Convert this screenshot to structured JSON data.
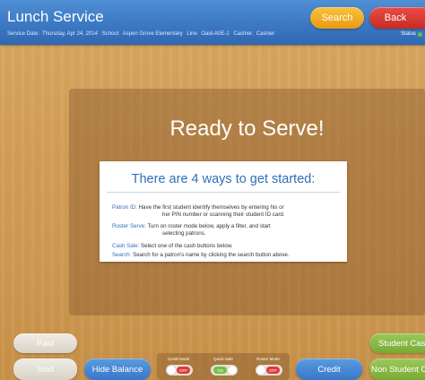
{
  "header": {
    "title": "Lunch Service",
    "info": {
      "service_date_label": "Service Date:",
      "service_date": "Thursday, Apr 24, 2014",
      "school_label": "School:",
      "school": "Aspen Grove Elementary",
      "line_label": "Line:",
      "line": "Oaid-A0E-1",
      "cashier_label": "Cashier:",
      "cashier": "Cashier"
    },
    "status_label": "Status",
    "search_label": "Search",
    "back_label": "Back"
  },
  "main": {
    "ready_title": "Ready to Serve!",
    "card_title": "There are 4 ways to get started:",
    "ways": [
      {
        "key": "Patron ID:",
        "text_line1": "Have the first student identify themselves by entering his or",
        "text_line2": "her PIN number or scanning their student ID card."
      },
      {
        "key": "Roster Serve:",
        "text_line1": "Turn on roster mode below, apply a filter, and start",
        "text_line2": "selecting patrons."
      },
      {
        "key": "Cash Sale:",
        "text_line1": "Select one of the cash buttons below."
      },
      {
        "key": "Search:",
        "text_line1": "Search for a patron's name by clicking the search button above."
      }
    ]
  },
  "footer": {
    "paid_label": "Paid",
    "void_label": "Void",
    "hide_balance_label": "Hide Balance",
    "credit_label": "Credit",
    "student_cash_label": "Student Cash",
    "non_student_cash_label": "Non Student Cash",
    "modes": [
      {
        "label": "Credit Mode",
        "state": "OFF"
      },
      {
        "label": "Quick Sale",
        "state": "ON"
      },
      {
        "label": "Roster Mode",
        "state": "OFF"
      }
    ]
  },
  "colors": {
    "header_blue": "#3c78c4",
    "search_orange": "#f0ad25",
    "back_red": "#d83a33",
    "accent_blue": "#2f6fb6",
    "green": "#8bba47",
    "toggle_off": "#e0383a",
    "toggle_on": "#76c043"
  }
}
